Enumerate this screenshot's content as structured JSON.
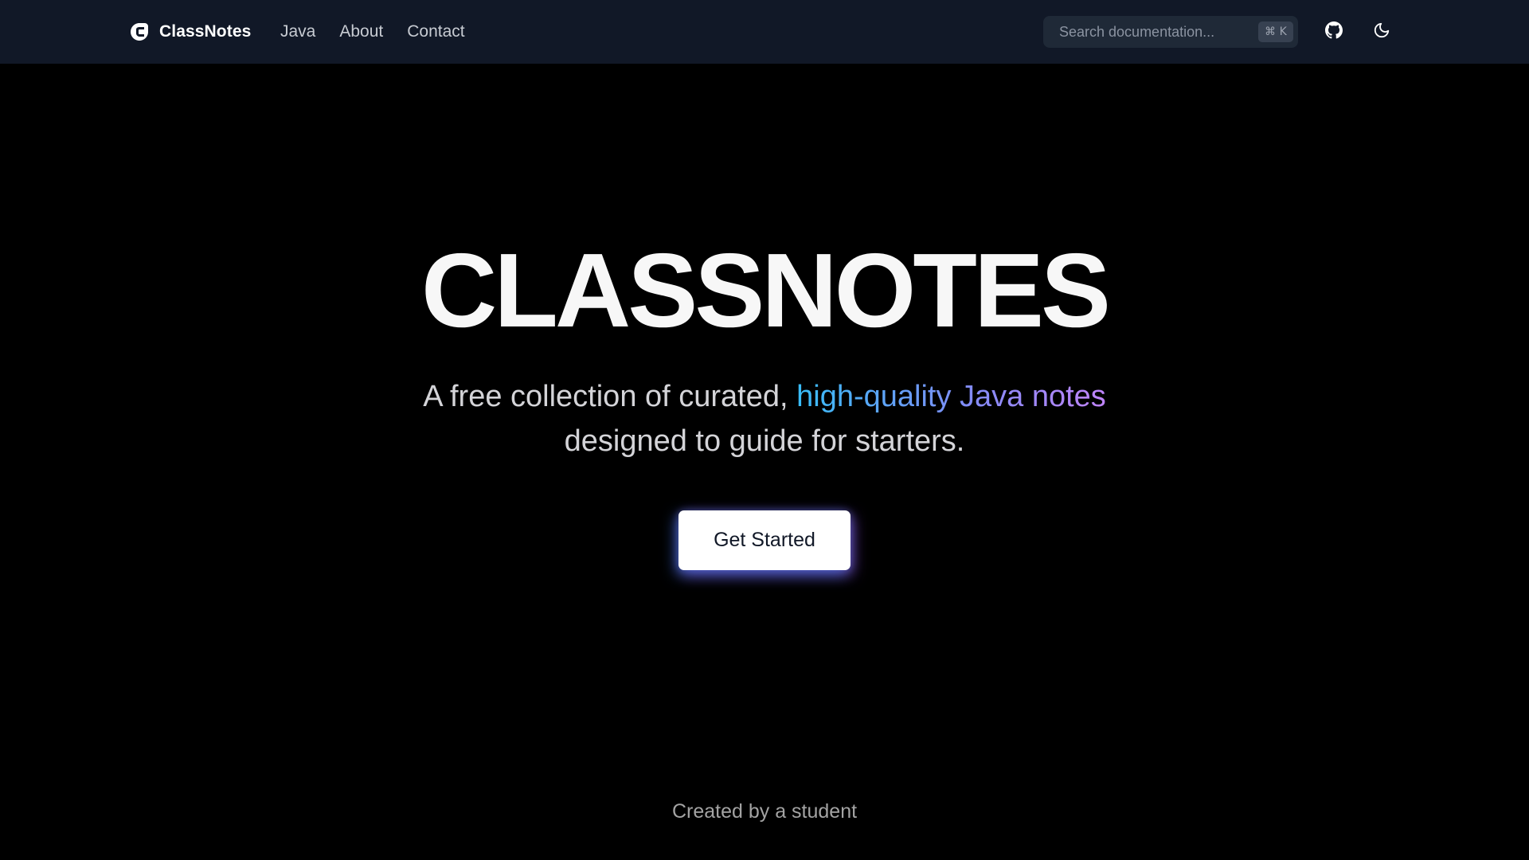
{
  "navbar": {
    "brand": "ClassNotes",
    "links": [
      {
        "label": "Java"
      },
      {
        "label": "About"
      },
      {
        "label": "Contact"
      }
    ],
    "search": {
      "placeholder": "Search documentation...",
      "shortcut": "⌘ K"
    },
    "icons": [
      "github-icon",
      "moon-icon"
    ]
  },
  "hero": {
    "title": "CLASSNOTES",
    "subtitle_part1": "A free collection of curated, ",
    "subtitle_highlight": "high-quality Java notes",
    "subtitle_part2": "designed to guide for starters.",
    "cta_label": "Get Started"
  },
  "footer": {
    "text": "Created by a student"
  },
  "colors": {
    "background": "#000000",
    "navbar": "#111827",
    "gradient_start": "#38bdf8",
    "gradient_end": "#c084fc",
    "cta_bg": "#ffffff"
  }
}
